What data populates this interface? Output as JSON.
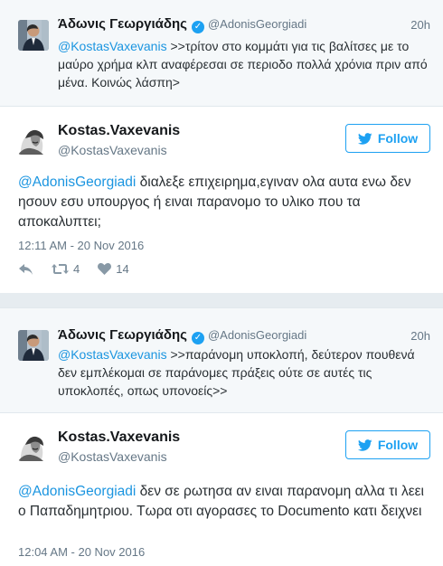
{
  "reply1": {
    "name": "Άδωνις Γεωργιάδης",
    "handle": "@AdonisGeorgiadi",
    "time": "20h",
    "mention": "@KostasVaxevanis",
    "text": " >>τρίτον στο κομμάτι για τις βαλίτσες με το μαύρο χρήμα κλπ αναφέρεσαι σε περιοδο πολλά χρόνια πριν από μένα. Κοινώς λάσπη>"
  },
  "tweet1": {
    "name": "Kostas.Vaxevanis",
    "handle": "@KostasVaxevanis",
    "follow_label": "Follow",
    "mention": "@AdonisGeorgiadi",
    "text": " διαλεξε επιχειρημα,εγιναν ολα αυτα ενω δεν ησουν εσυ υπουργος ή ειναι παρανομο το υλικο που τα αποκαλυπτει;",
    "timestamp": "12:11 AM - 20 Nov 2016",
    "retweets": "4",
    "likes": "14"
  },
  "reply2": {
    "name": "Άδωνις Γεωργιάδης",
    "handle": "@AdonisGeorgiadi",
    "time": "20h",
    "mention": "@KostasVaxevanis",
    "text": " >>παράνομη υποκλοπή, δεύτερον πουθενά δεν εμπλέκομαι σε παράνομες πράξεις ούτε σε αυτές τις υποκλοπές, οπως υπονοείς>>"
  },
  "tweet2": {
    "name": "Kostas.Vaxevanis",
    "handle": "@KostasVaxevanis",
    "follow_label": "Follow",
    "mention": "@AdonisGeorgiadi",
    "text": " δεν σε ρωτησα αν ειναι παρανομη αλλα τι λεει ο Παπαδημητριου. Τωρα οτι αγορασες το Documento κατι δειχνει",
    "timestamp": "12:04 AM - 20 Nov 2016"
  },
  "colors": {
    "accent": "#1da1f2",
    "link": "#1b95e0",
    "muted": "#657786"
  },
  "icons": {
    "verified": "verified-badge-icon",
    "bird": "twitter-bird-icon",
    "reply": "reply-icon",
    "retweet": "retweet-icon",
    "like": "heart-icon"
  }
}
